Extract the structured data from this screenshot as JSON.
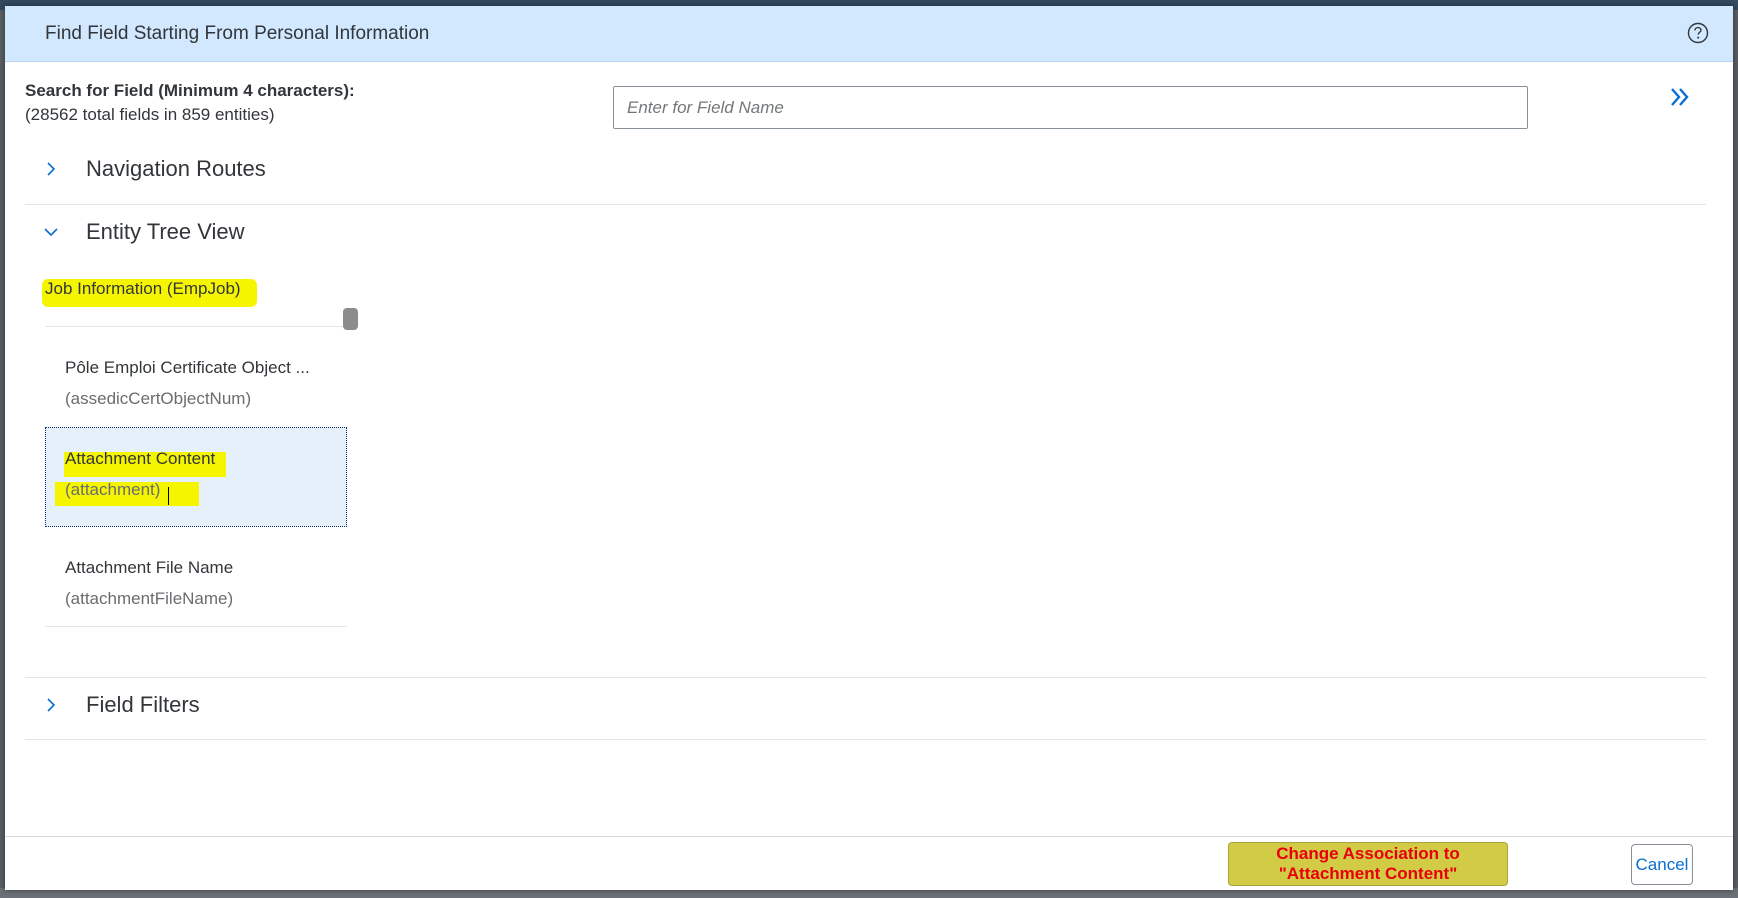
{
  "dialog": {
    "title": "Find Field Starting From Personal Information",
    "help_icon": "help-circle-icon"
  },
  "search": {
    "label": "Search for Field (Minimum 4 characters):",
    "count_text": "(28562 total fields in 859 entities)",
    "placeholder": "Enter for Field Name",
    "value": "",
    "expand_icon": "double-chevron-right-icon"
  },
  "panels": {
    "navigation_routes": {
      "title": "Navigation Routes",
      "expanded": false
    },
    "entity_tree_view": {
      "title": "Entity Tree View",
      "expanded": true
    },
    "field_filters": {
      "title": "Field Filters",
      "expanded": false
    }
  },
  "entity_tree": {
    "entity_title": "Job Information (EmpJob)",
    "fields": [
      {
        "name": "Pôle Emploi Certificate Object ...",
        "technical": "(assedicCertObjectNum)",
        "selected": false
      },
      {
        "name": "Attachment Content",
        "technical": "(attachment)",
        "selected": true
      },
      {
        "name": "Attachment File Name",
        "technical": "(attachmentFileName)",
        "selected": false
      }
    ]
  },
  "footer": {
    "change_button": "Change Association to \"Attachment Content\"",
    "cancel_button": "Cancel"
  },
  "colors": {
    "header_bg": "#d1e8ff",
    "highlight": "#f5f500",
    "selected_bg": "#e5f0fa",
    "change_button_bg": "#d2cb45",
    "change_button_text": "#e8000a",
    "link_blue": "#0a6ed1"
  }
}
